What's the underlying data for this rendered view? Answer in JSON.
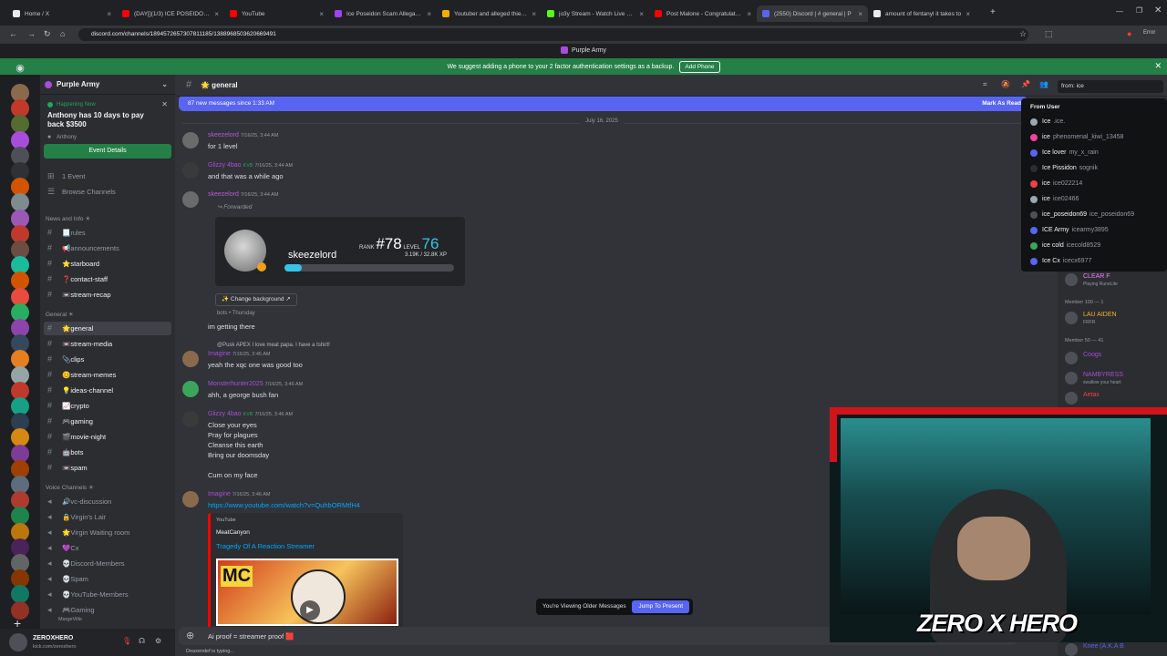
{
  "browser": {
    "tabs": [
      {
        "label": "Home / X",
        "color": "#e8eaed"
      },
      {
        "label": "(DAY[](1/3) ICE POSEIDON'S J",
        "color": "#ff0000"
      },
      {
        "label": "YouTube",
        "color": "#ff0000"
      },
      {
        "label": "Ice Poseidon Scam Allegations",
        "color": "#a142f4"
      },
      {
        "label": "Youtuber and alleged thief puts",
        "color": "#f9ab00"
      },
      {
        "label": "jo3y Stream - Watch Live on Ki",
        "color": "#53fc18"
      },
      {
        "label": "Post Malone - Congratulations",
        "color": "#ff0000"
      },
      {
        "label": "(2550) Discord | # general | P",
        "color": "#5865f2"
      },
      {
        "label": "amount of fentanyl it takes to",
        "color": "#e8eaed"
      }
    ],
    "url": "discord.com/channels/1894572657307811185/1388968503620669491",
    "window_title": "Purple Army"
  },
  "banner": {
    "text": "We suggest adding a phone to your 2 factor authentication settings as a backup.",
    "button": "Add Phone"
  },
  "server": {
    "name": "Purple Army"
  },
  "event": {
    "tag": "Happening Now",
    "title": "Anthony has 10 days to pay back $3500",
    "host": "Anthony",
    "button": "Event Details"
  },
  "sidebar": {
    "top_items": [
      {
        "label": "1 Event",
        "count": "1"
      },
      {
        "label": "Browse Channels"
      }
    ],
    "categories": [
      {
        "label": "News and Info ☀"
      },
      {
        "label": "General ☀"
      },
      {
        "label": "Voice Channels ☀"
      }
    ],
    "channels": [
      {
        "label": "📃rules"
      },
      {
        "label": "📢announcements"
      },
      {
        "label": "⭐starboard"
      },
      {
        "label": "❓contact-staff"
      },
      {
        "label": "📼stream-recap"
      },
      {
        "label": "🌟general"
      },
      {
        "label": "📼stream-media"
      },
      {
        "label": "📎clips"
      },
      {
        "label": "😊stream-memes"
      },
      {
        "label": "💡ideas-channel"
      },
      {
        "label": "📈crypto"
      },
      {
        "label": "🎮gaming"
      },
      {
        "label": "🎬movie-night"
      },
      {
        "label": "🤖bots"
      },
      {
        "label": "📼spam"
      },
      {
        "label": "🔊vc-discussion"
      },
      {
        "label": "🔒Virgin's Lair"
      },
      {
        "label": "🌟Virgin Waiting room"
      },
      {
        "label": "💜Cx"
      },
      {
        "label": "💀Discord-Members"
      },
      {
        "label": "💀Spam"
      },
      {
        "label": "💀YouTube-Members"
      },
      {
        "label": "🎮Gaming"
      }
    ],
    "voice_user": "MargeVille"
  },
  "user_panel": {
    "name": "ZEROXHERO",
    "status": "kick.com/zeroxhero"
  },
  "channel": {
    "name": "🌟 general"
  },
  "new_messages": {
    "text": "87 new messages since 1:33 AM",
    "mark": "Mark As Read"
  },
  "date_divider": "July 16, 2025",
  "messages": [
    {
      "author": "skeezelord",
      "time": "7/16/25, 3:44 AM",
      "lines": [
        "for 1 level"
      ],
      "color": "#b45cd6"
    },
    {
      "author": "Glizzy 4bao",
      "tag": "KVB",
      "time": "7/16/25, 3:44 AM",
      "lines": [
        "and that was a while ago"
      ],
      "color": "#a84ddb"
    },
    {
      "author": "skeezelord",
      "time": "7/16/25, 3:44 AM",
      "lines": [
        "Forwarded"
      ],
      "color": "#b45cd6"
    },
    {
      "author": "Imagine",
      "time": "7/16/25, 3:45 AM",
      "lines": [
        "yeah the xqc one was good too"
      ],
      "color": "#a84ddb"
    },
    {
      "author": "Monsterhunter2025",
      "time": "7/16/25, 3:46 AM",
      "lines": [
        "ahh, a george bush fan"
      ],
      "color": "#a84ddb"
    },
    {
      "author": "Glizzy 4bao",
      "tag": "KVB",
      "time": "7/16/25, 3:46 AM",
      "lines": [
        "Close your eyes",
        "Pray for plagues",
        "Cleanse this earth",
        "Bring our doomsday",
        "",
        "Cum on my face"
      ],
      "color": "#a84ddb"
    },
    {
      "author": "Imagine",
      "time": "7/16/25, 3:46 AM",
      "lines": [
        "https://www.youtube.com/watch?v=QuhbORMtfH4"
      ],
      "color": "#a84ddb"
    }
  ],
  "rank_card": {
    "rank": "#78",
    "level": "76",
    "name": "skeezelord",
    "xp": "3.19K / 32.8K XP",
    "progress": 0.1,
    "change_bg": "Change background",
    "footer": "bots • Thursday"
  },
  "after_card_text": "im getting there",
  "reply_preview": "@Pusk APEX I love meat papa. I have a tshirt!",
  "embed": {
    "provider": "YouTube",
    "author": "MeatCanyon",
    "title": "Tragedy Of A Reaction Streamer",
    "thumb_text": "MC"
  },
  "older_bar": {
    "text": "You're Viewing Older Messages",
    "button": "Jump To Present"
  },
  "composer": {
    "text": "Ai proof = streamer proof 🟥",
    "typing": "Deaxendef is typing..."
  },
  "search": {
    "query": "from: ice",
    "header": "From User",
    "results": [
      {
        "name": "Ice",
        "user": ".ice.",
        "color": "#99aab5"
      },
      {
        "name": "ice",
        "user": "phenomenal_kiwi_13458",
        "color": "#eb459e"
      },
      {
        "name": "Ice lover",
        "user": "my_x_rain",
        "color": "#5865f2"
      },
      {
        "name": "Ice Pissidon",
        "user": "sognik",
        "color": "#2b2d31"
      },
      {
        "name": "ice",
        "user": "ice022214",
        "color": "#ed4245"
      },
      {
        "name": "ice",
        "user": "ice02466",
        "color": "#99aab5"
      },
      {
        "name": "ice_poseidon69",
        "user": "ice_poseidon69",
        "color": "#4e5058"
      },
      {
        "name": "ICE Army",
        "user": "icearmy3895",
        "color": "#5865f2"
      },
      {
        "name": "ice cold",
        "user": "icecold8529",
        "color": "#3ba55c"
      },
      {
        "name": "Ice Cx",
        "user": "icecx6977",
        "color": "#5865f2"
      }
    ]
  },
  "members": {
    "items": [
      {
        "name": "CLEAR F",
        "sub": "Playing RuneLite",
        "color": "#f47fff"
      },
      {
        "name": "Member 100 — 1",
        "sub": "",
        "color": "#949ba4"
      },
      {
        "name": "LAU AIDEN",
        "sub": "FRFR",
        "color": "#f0b232"
      },
      {
        "name": "Member 50 — 41",
        "sub": "",
        "color": "#949ba4"
      },
      {
        "name": "Coogs",
        "sub": "",
        "color": "#a84ddb"
      },
      {
        "name": "NAMBYRESS",
        "sub": "swallow your heart",
        "color": "#a84ddb"
      },
      {
        "name": "Aetax",
        "sub": "",
        "color": "#ed4245"
      },
      {
        "name": "Knee (A.K.A B",
        "sub": "",
        "color": "#5865f2"
      }
    ]
  },
  "webcam": {
    "overlay": "ZERO X HERO"
  }
}
